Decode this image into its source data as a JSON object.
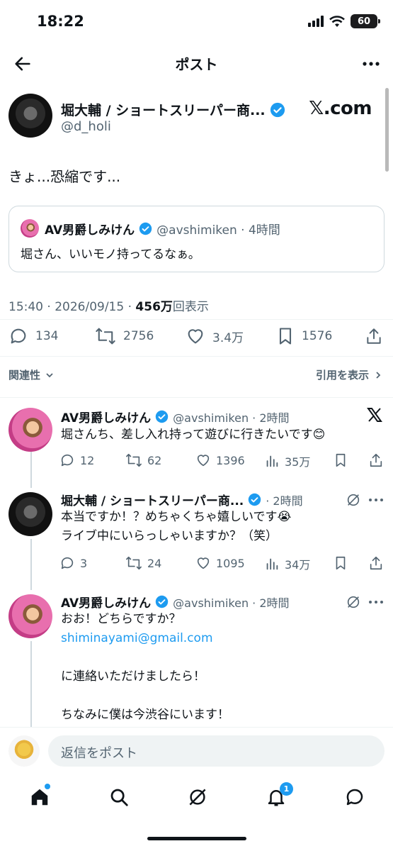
{
  "status": {
    "time": "18:22",
    "battery": "60"
  },
  "nav": {
    "title": "ポスト"
  },
  "post": {
    "author_name": "堀大輔 / ショートスリーパー商...",
    "handle": "@d_holi",
    "badge_text": "𝕏.com",
    "text": "きょ...恐縮です...",
    "quote": {
      "author": "AV男爵しみけん",
      "handle_time": "@avshimiken · 4時間",
      "text": "堀さん、いいモノ持ってるなぁ。"
    },
    "meta": {
      "datetime": "15:40 · 2026/09/15 · ",
      "views": "456万",
      "views_label": "回表示"
    },
    "actions": {
      "replies": "134",
      "reposts": "2756",
      "likes": "3.4万",
      "bookmarks": "1576"
    }
  },
  "filters": {
    "sort": "関連性",
    "quotes": "引用を表示"
  },
  "replies": [
    {
      "name": "AV男爵しみけん",
      "meta": "@avshimiken · 2時間",
      "lines": [
        "堀さんち、差し入れ持って遊びに行きたいです😊"
      ],
      "stats": {
        "replies": "12",
        "reposts": "62",
        "likes": "1396",
        "views": "35万"
      }
    },
    {
      "name": "堀大輔 / ショートスリーパー商...",
      "meta": "· 2時間",
      "lines": [
        "本当ですか！？めちゃくちゃ嬉しいです😭",
        "ライブ中にいらっしゃいますか？（笑）"
      ],
      "stats": {
        "replies": "3",
        "reposts": "24",
        "likes": "1095",
        "views": "34万"
      }
    },
    {
      "name": "AV男爵しみけん",
      "meta": "@avshimiken · 2時間",
      "lines": [
        "おお！どちらですか？",
        "shiminayami@gmail.com",
        "",
        "に連絡いただけましたら！",
        "",
        "ちなみに僕は今渋谷にいます！"
      ]
    }
  ],
  "compose": {
    "placeholder": "返信をポスト"
  },
  "tabs": {
    "notifications_badge": "1"
  },
  "colors": {
    "accent": "#1d9bf0",
    "text": "#0f1419",
    "muted": "#536471"
  }
}
